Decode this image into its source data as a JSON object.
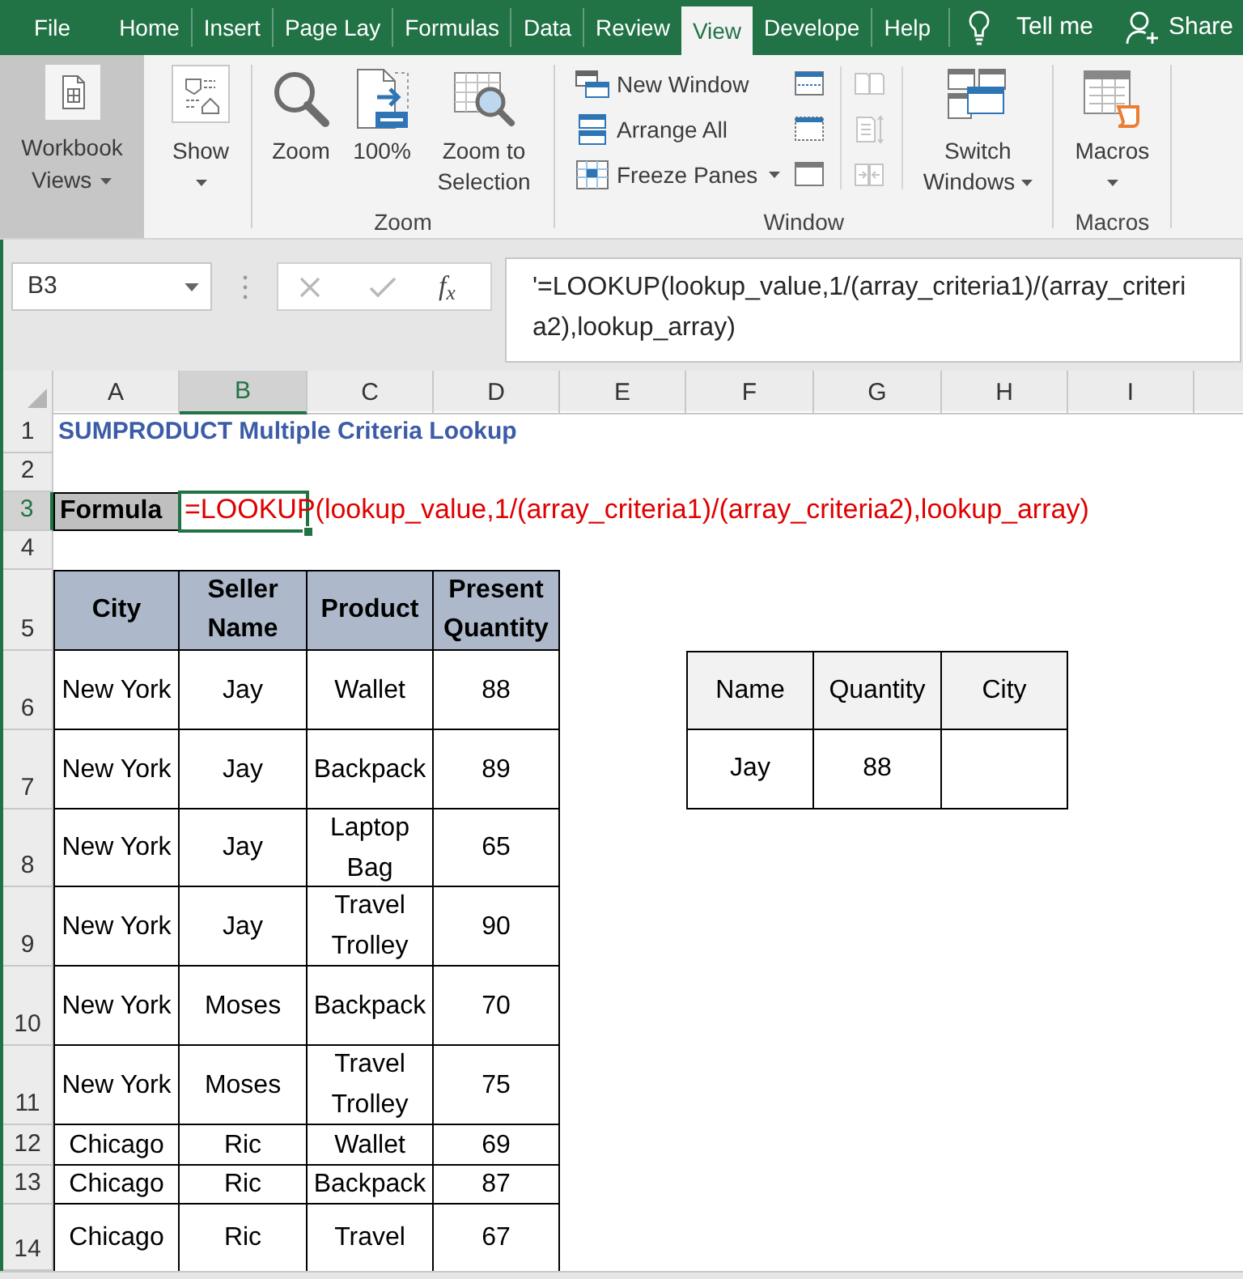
{
  "tabs": [
    {
      "label": "File",
      "selected": false
    },
    {
      "label": "Home",
      "selected": false
    },
    {
      "label": "Insert",
      "selected": false
    },
    {
      "label": "Page Lay",
      "selected": false
    },
    {
      "label": "Formulas",
      "selected": false
    },
    {
      "label": "Data",
      "selected": false
    },
    {
      "label": "Review",
      "selected": false
    },
    {
      "label": "View",
      "selected": true
    },
    {
      "label": "Develope",
      "selected": false
    },
    {
      "label": "Help",
      "selected": false
    }
  ],
  "tell_me": "Tell me",
  "share": "Share",
  "ribbon": {
    "collapsed_groups": [
      {
        "label": "Workbook Views",
        "highlighted": true
      },
      {
        "label": "Show",
        "highlighted": false
      }
    ],
    "zoom_group": {
      "label": "Zoom",
      "buttons": [
        "Zoom",
        "100%",
        "Zoom to Selection"
      ]
    },
    "window_group": {
      "label": "Window",
      "buttons": [
        {
          "label": "New Window",
          "dropdown": false
        },
        {
          "label": "Arrange All",
          "dropdown": false
        },
        {
          "label": "Freeze Panes",
          "dropdown": true
        }
      ],
      "icon_buttons": [
        {
          "disabled": false
        },
        {
          "disabled": false
        },
        {
          "disabled": false
        },
        {
          "disabled": true
        },
        {
          "disabled": true
        },
        {
          "disabled": true
        }
      ],
      "switch_windows": "Switch Windows"
    },
    "macros_group": {
      "label": "Macros",
      "button": "Macros"
    }
  },
  "formula_bar": {
    "name_box": "B3",
    "edit_buttons_disabled": true,
    "function_button": "f$_{x}$",
    "formula": "'=LOOKUP(lookup_value,1/(array_criteria1)/(array_criteria2),lookup_array)"
  },
  "sheet": {
    "columns": [
      {
        "label": "A",
        "selected": false
      },
      {
        "label": "B",
        "selected": true
      },
      {
        "label": "C",
        "selected": false
      },
      {
        "label": "D",
        "selected": false
      },
      {
        "label": "E",
        "selected": false
      },
      {
        "label": "F",
        "selected": false
      },
      {
        "label": "G",
        "selected": false
      },
      {
        "label": "H",
        "selected": false
      },
      {
        "label": "I",
        "selected": false
      }
    ],
    "rows": [
      {
        "label": "1",
        "selected": false
      },
      {
        "label": "2",
        "selected": false
      },
      {
        "label": "3",
        "selected": true
      },
      {
        "label": "4",
        "selected": false
      },
      {
        "label": "5",
        "selected": false
      },
      {
        "label": "6",
        "selected": false
      },
      {
        "label": "7",
        "selected": false
      },
      {
        "label": "8",
        "selected": false
      },
      {
        "label": "9",
        "selected": false
      },
      {
        "label": "10",
        "selected": false
      },
      {
        "label": "11",
        "selected": false
      },
      {
        "label": "12",
        "selected": false
      },
      {
        "label": "13",
        "selected": false
      },
      {
        "label": "14",
        "selected": false
      }
    ],
    "title": "SUMPRODUCT Multiple Criteria Lookup",
    "formula_label": "Formula",
    "formula_text": "=LOOKUP(lookup_value,1/(array_criteria1)/(array_criteria2),lookup_array)",
    "data_table": {
      "columns": [
        "City",
        "Seller Name",
        "Product",
        "Present Quantity"
      ],
      "rows": [
        [
          "New York",
          "Jay",
          "Wallet",
          "88"
        ],
        [
          "New York",
          "Jay",
          "Backpack",
          "89"
        ],
        [
          "New York",
          "Jay",
          "Laptop Bag",
          "65"
        ],
        [
          "New York",
          "Jay",
          "Travel Trolley",
          "90"
        ],
        [
          "New York",
          "Moses",
          "Backpack",
          "70"
        ],
        [
          "New York",
          "Moses",
          "Travel Trolley",
          "75"
        ],
        [
          "Chicago",
          "Ric",
          "Wallet",
          "69"
        ],
        [
          "Chicago",
          "Ric",
          "Backpack",
          "87"
        ],
        [
          "Chicago",
          "Ric",
          "Travel",
          "67"
        ]
      ]
    },
    "lookup_table": {
      "columns": [
        "Name",
        "Quantity",
        "City"
      ],
      "rows": [
        [
          "Jay",
          "88"
        ]
      ]
    }
  }
}
